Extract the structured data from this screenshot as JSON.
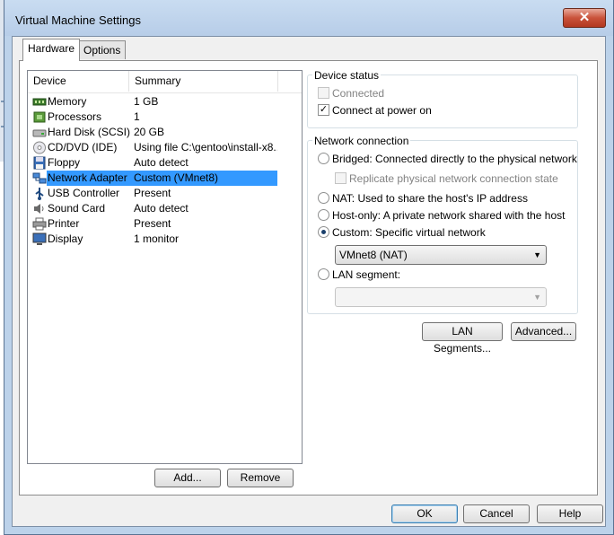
{
  "window": {
    "title": "Virtual Machine Settings",
    "close_glyph": "✕"
  },
  "tabs": [
    {
      "label": "Hardware"
    },
    {
      "label": "Options"
    }
  ],
  "device_list": {
    "columns": {
      "device": "Device",
      "summary": "Summary"
    },
    "rows": [
      {
        "name": "Memory",
        "summary": "1 GB",
        "icon": "memory-icon"
      },
      {
        "name": "Processors",
        "summary": "1",
        "icon": "processor-icon"
      },
      {
        "name": "Hard Disk (SCSI)",
        "summary": "20 GB",
        "icon": "hard-disk-icon"
      },
      {
        "name": "CD/DVD (IDE)",
        "summary": "Using file C:\\gentoo\\install-x8...",
        "icon": "cd-dvd-icon"
      },
      {
        "name": "Floppy",
        "summary": "Auto detect",
        "icon": "floppy-icon"
      },
      {
        "name": "Network Adapter",
        "summary": "Custom (VMnet8)",
        "icon": "network-adapter-icon",
        "selected": true
      },
      {
        "name": "USB Controller",
        "summary": "Present",
        "icon": "usb-icon"
      },
      {
        "name": "Sound Card",
        "summary": "Auto detect",
        "icon": "sound-card-icon"
      },
      {
        "name": "Printer",
        "summary": "Present",
        "icon": "printer-icon"
      },
      {
        "name": "Display",
        "summary": "1 monitor",
        "icon": "display-icon"
      }
    ],
    "add_label": "Add...",
    "remove_label": "Remove"
  },
  "device_status": {
    "title": "Device status",
    "connected": {
      "label": "Connected",
      "checked": false,
      "enabled": false
    },
    "connect_at_power_on": {
      "label": "Connect at power on",
      "checked": true
    }
  },
  "network_connection": {
    "title": "Network connection",
    "bridged": "Bridged: Connected directly to the physical network",
    "replicate": "Replicate physical network connection state",
    "nat": "NAT: Used to share the host's IP address",
    "host_only": "Host-only: A private network shared with the host",
    "custom": "Custom: Specific virtual network",
    "custom_value": "VMnet8 (NAT)",
    "lan_segment": "LAN segment:",
    "lan_segment_value": "",
    "selected": "custom"
  },
  "buttons": {
    "lan_segments": "LAN Segments...",
    "advanced": "Advanced...",
    "ok": "OK",
    "cancel": "Cancel",
    "help": "Help"
  },
  "check_glyph": "✓",
  "dropdown_glyph": "▼"
}
